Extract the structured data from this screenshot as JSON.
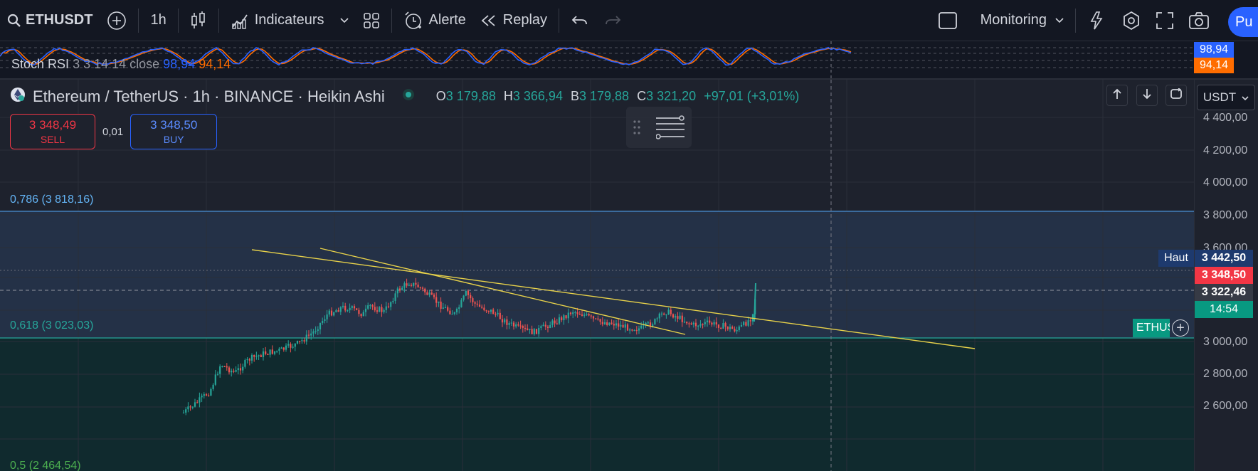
{
  "topbar": {
    "symbol": "ETHUSDT",
    "interval": "1h",
    "indicators_label": "Indicateurs",
    "alert_label": "Alerte",
    "replay_label": "Replay",
    "monitoring_label": "Monitoring",
    "publish_label": "Pu"
  },
  "stoch": {
    "label": "Stoch RSI",
    "params": "3 3 14 14 close",
    "k_value": "98,94",
    "d_value": "94,14",
    "k_color": "#2962ff",
    "d_color": "#ff6d00"
  },
  "legend": {
    "title": "Ethereum / TetherUS · 1h · BINANCE · Heikin Ashi",
    "o_label": "O",
    "o_value": "3 179,88",
    "h_label": "H",
    "h_value": "3 366,94",
    "b_label": "B",
    "b_value": "3 179,88",
    "c_label": "C",
    "c_value": "3 321,20",
    "change": "+97,01",
    "change_pct": "(+3,01%)"
  },
  "trade": {
    "sell_price": "3 348,49",
    "sell_label": "SELL",
    "spread": "0,01",
    "buy_price": "3 348,50",
    "buy_label": "BUY"
  },
  "fib": {
    "level_786": "0,786 (3 818,16)",
    "level_618": "0,618 (3 023,03)",
    "level_5": "0,5 (2 464,54)"
  },
  "axis": {
    "currency": "USDT",
    "ticks": [
      "4 400,00",
      "4 200,00",
      "4 000,00",
      "3 800,00",
      "3 600,00",
      "3 000,00",
      "2 800,00",
      "2 600,00"
    ],
    "high_label": "Haut",
    "high_value": "3 442,50",
    "ask_value": "3 348,50",
    "last_value": "3 322,46",
    "countdown": "14:54",
    "symbol_tag": "ETHUSDT"
  },
  "colors": {
    "up": "#26a69a",
    "down": "#ef5350",
    "trendline": "#e8d24a",
    "accent": "#2962ff"
  }
}
